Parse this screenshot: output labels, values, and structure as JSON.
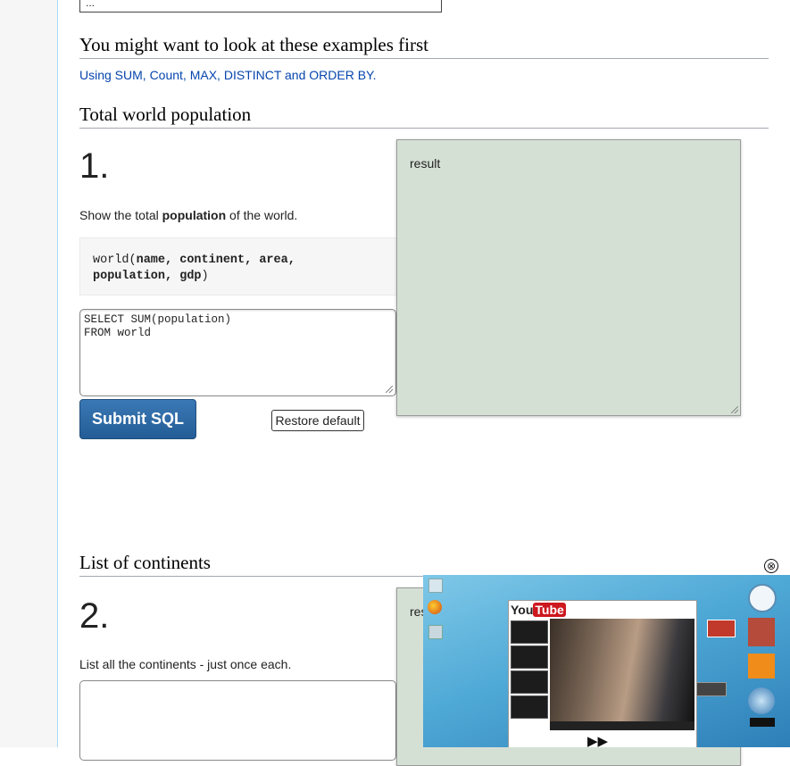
{
  "top_input": {
    "value": "..."
  },
  "examples": {
    "heading": "You might want to look at these examples first",
    "link": "Using SUM, Count, MAX, DISTINCT and ORDER BY."
  },
  "section1": {
    "heading": "Total world population",
    "number": "1.",
    "prompt_before": "Show the total ",
    "prompt_bold": "population",
    "prompt_after": " of the world.",
    "schema_table": "world(",
    "schema_cols_line1": "name, continent, area,",
    "schema_cols_line2": "population, gdp",
    "schema_close": ")",
    "sql": "SELECT SUM(population)\nFROM world",
    "result_label": "result",
    "submit_label": "Submit SQL",
    "restore_label": "Restore default"
  },
  "section2": {
    "heading": "List of continents",
    "number": "2.",
    "prompt": "List all the continents - just once each.",
    "result_label": "res"
  },
  "popup": {
    "youtube_logo_you": "You",
    "youtube_logo_tube": "Tube",
    "close_symbol": "⊗",
    "forward_symbol": "▶▶"
  }
}
